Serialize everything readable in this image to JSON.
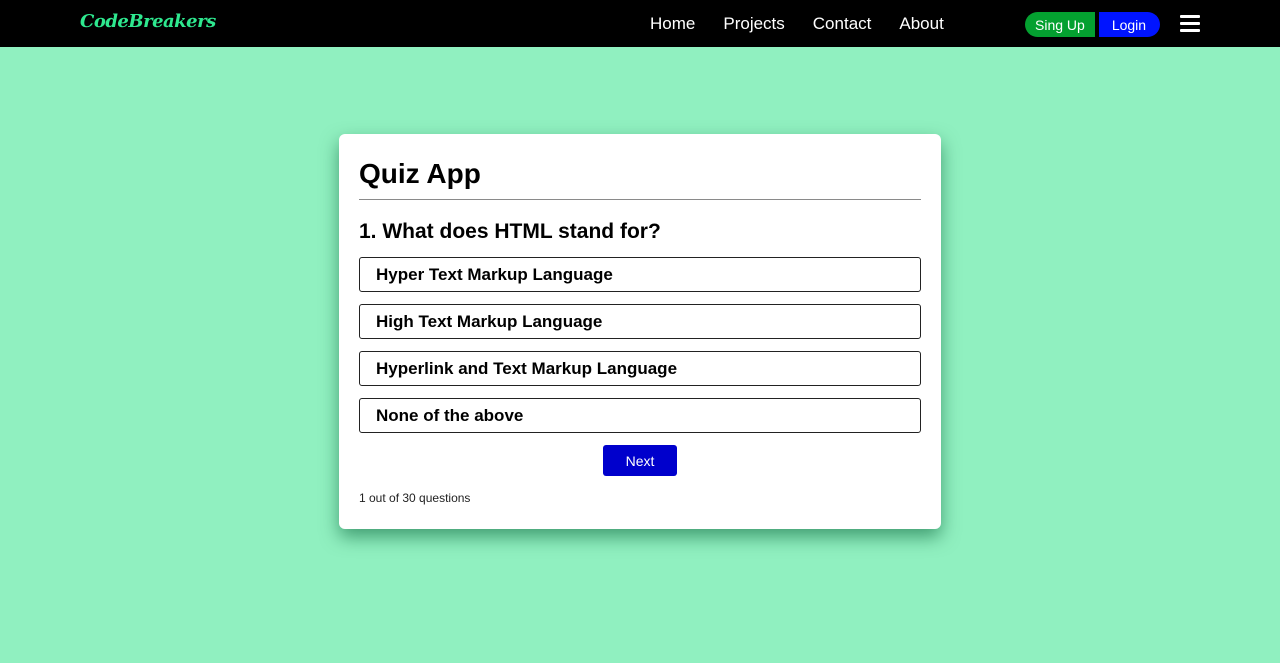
{
  "navbar": {
    "brand": "CodeBreakers",
    "links": [
      "Home",
      "Projects",
      "Contact",
      "About"
    ],
    "signup_label": "Sing Up",
    "login_label": "Login",
    "menu_icon": "hamburger-menu-icon"
  },
  "quiz": {
    "title": "Quiz App",
    "question": "1. What does HTML stand for?",
    "options": [
      "Hyper Text Markup Language",
      "High Text Markup Language",
      "Hyperlink and Text Markup Language",
      "None of the above"
    ],
    "next_label": "Next",
    "progress": "1 out of 30 questions"
  },
  "colors": {
    "background": "#90f0c0",
    "navbar": "#000000",
    "brand": "#2ee88f",
    "signup": "#04a030",
    "login": "#0014ff",
    "next": "#0000cc"
  }
}
